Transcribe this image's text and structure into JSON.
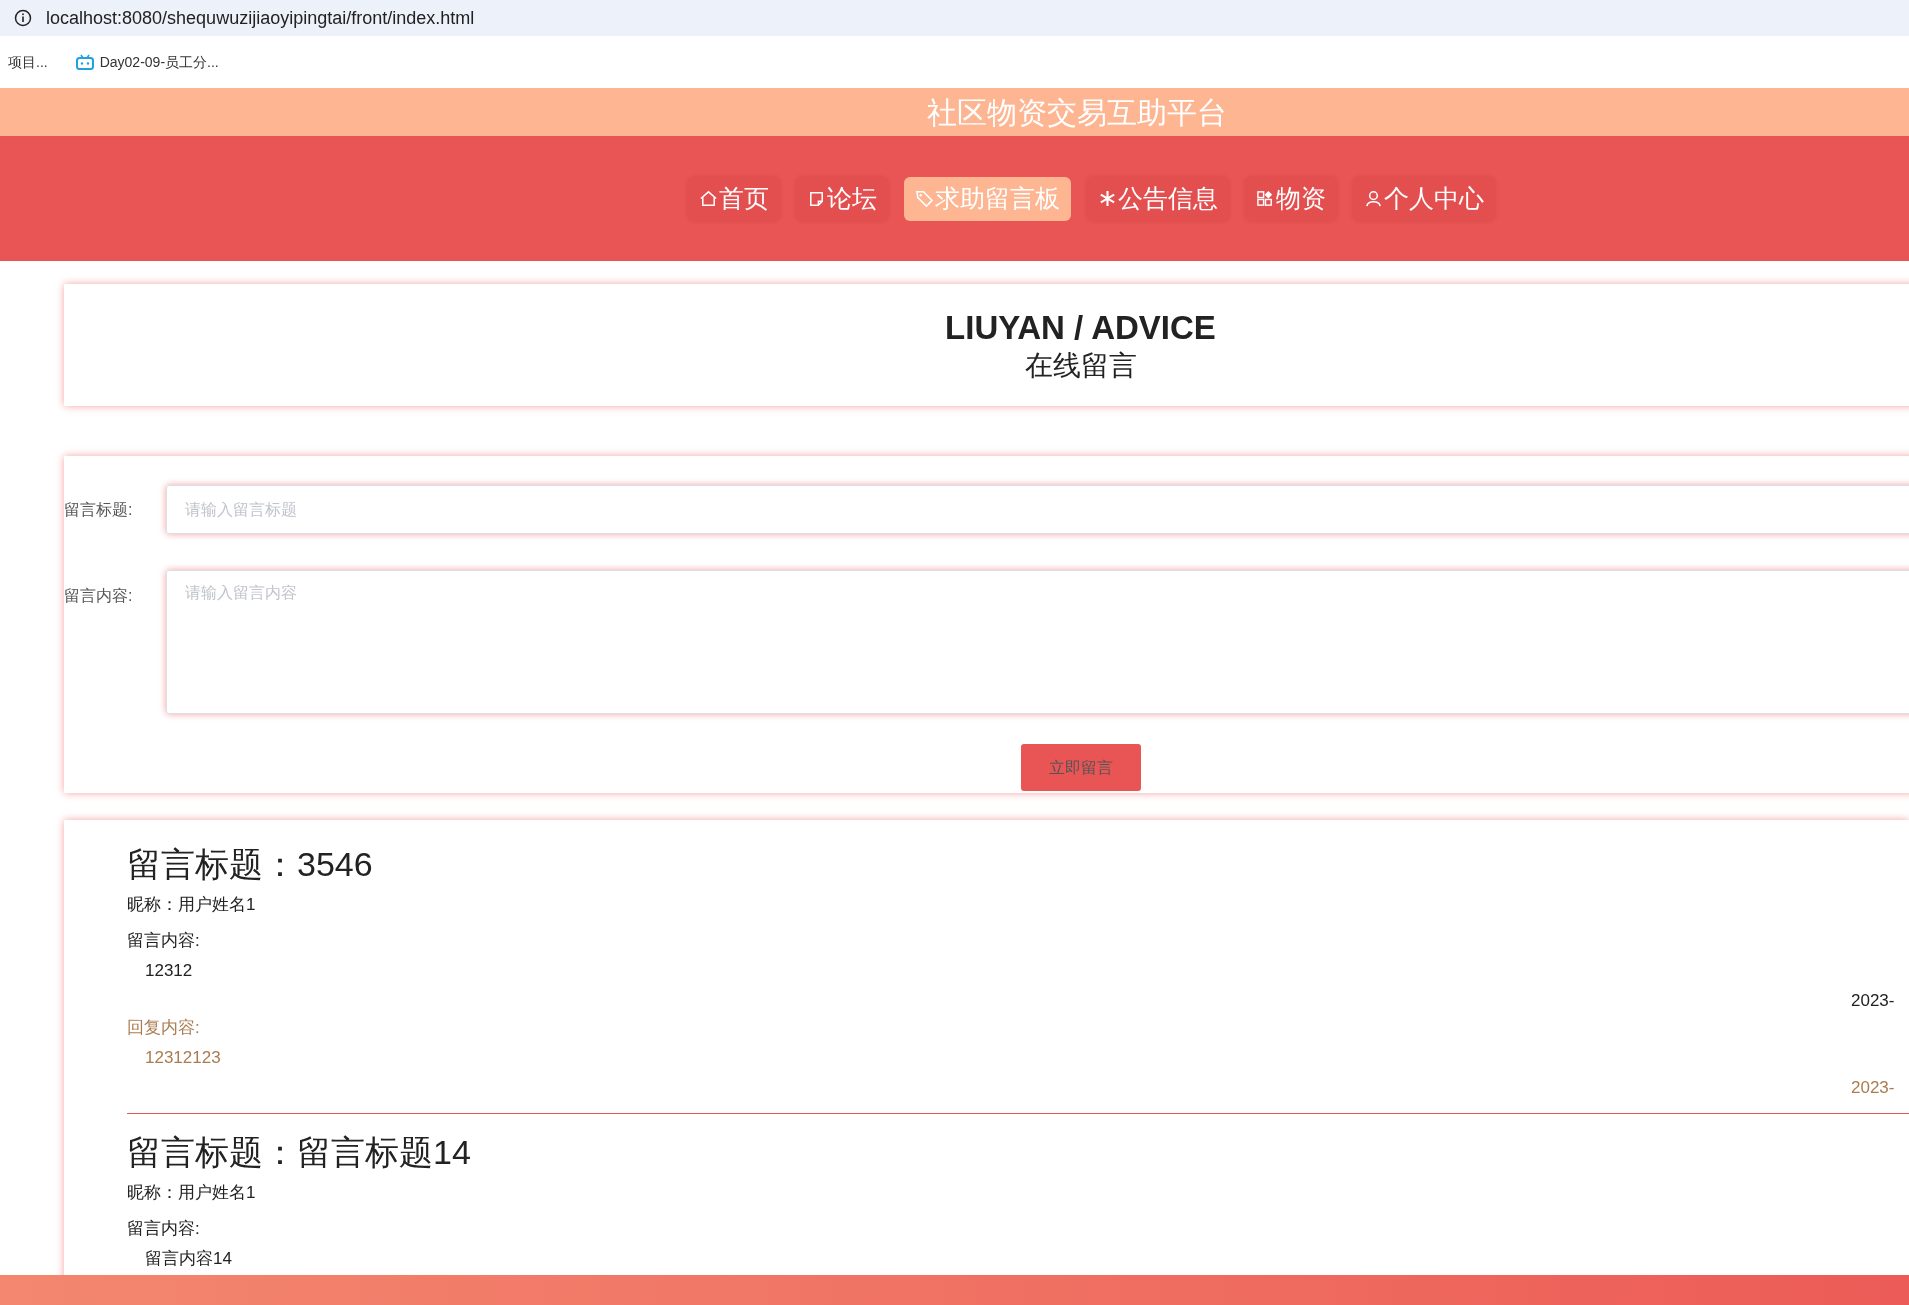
{
  "browser": {
    "url": "localhost:8080/shequwuzijiaoyipingtai/front/index.html",
    "bookmarks": [
      {
        "label": "项目..."
      },
      {
        "label": "Day02-09-员工分..."
      }
    ]
  },
  "site_title": "社区物资交易互助平台",
  "nav": [
    {
      "label": "首页",
      "selected": false
    },
    {
      "label": "论坛",
      "selected": false
    },
    {
      "label": "求助留言板",
      "selected": true
    },
    {
      "label": "公告信息",
      "selected": false
    },
    {
      "label": "物资",
      "selected": false
    },
    {
      "label": "个人中心",
      "selected": false
    }
  ],
  "heading": {
    "title": "LIUYAN / ADVICE",
    "subtitle": "在线留言"
  },
  "form": {
    "title_label": "留言标题:",
    "title_placeholder": "请输入留言标题",
    "content_label": "留言内容:",
    "content_placeholder": "请输入留言内容",
    "submit": "立即留言"
  },
  "messages": [
    {
      "title": "留言标题：3546",
      "nickname": "昵称：用户姓名1",
      "content_label": "留言内容:",
      "content": "12312",
      "date": "2023-",
      "reply_label": "回复内容:",
      "reply": "12312123",
      "reply_date": "2023-"
    },
    {
      "title": "留言标题：留言标题14",
      "nickname": "昵称：用户姓名1",
      "content_label": "留言内容:",
      "content": "留言内容14"
    }
  ]
}
